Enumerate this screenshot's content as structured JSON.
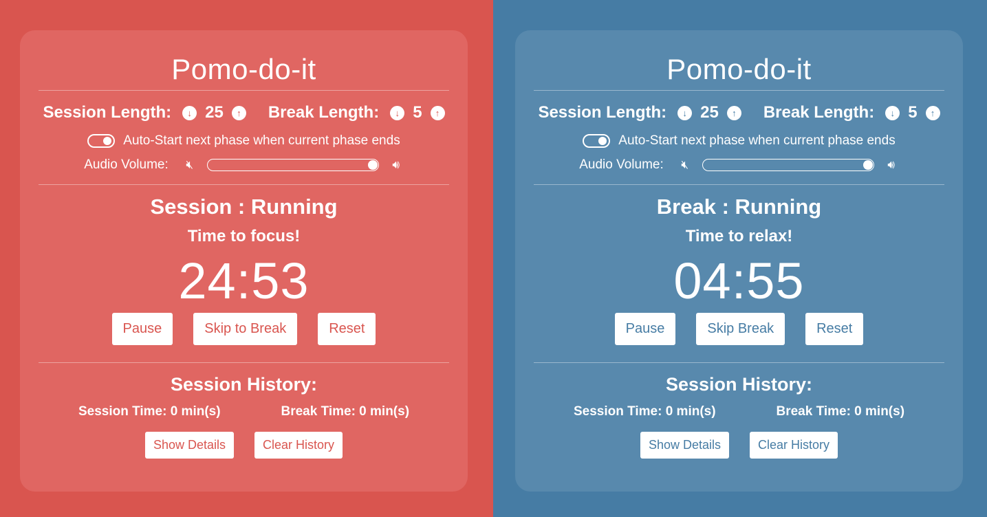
{
  "panels": [
    {
      "theme": "session",
      "accent_color": "#d9554f",
      "title": "Pomo-do-it",
      "session_length_label": "Session Length:",
      "session_length_value": "25",
      "break_length_label": "Break Length:",
      "break_length_value": "5",
      "decrement_icon": "arrow-down-icon",
      "increment_icon": "arrow-up-icon",
      "autostart_label": "Auto-Start next phase when current phase ends",
      "autostart_enabled": true,
      "volume_label": "Audio Volume:",
      "volume_level": 1.0,
      "status": "Session : Running",
      "message": "Time to focus!",
      "timer": "24:53",
      "pause_label": "Pause",
      "skip_label": "Skip to Break",
      "reset_label": "Reset",
      "history_title": "Session History:",
      "history_session_time": "Session Time: 0 min(s)",
      "history_break_time": "Break Time: 0 min(s)",
      "show_details_label": "Show Details",
      "clear_history_label": "Clear History"
    },
    {
      "theme": "break",
      "accent_color": "#467ca4",
      "title": "Pomo-do-it",
      "session_length_label": "Session Length:",
      "session_length_value": "25",
      "break_length_label": "Break Length:",
      "break_length_value": "5",
      "decrement_icon": "arrow-down-icon",
      "increment_icon": "arrow-up-icon",
      "autostart_label": "Auto-Start next phase when current phase ends",
      "autostart_enabled": true,
      "volume_label": "Audio Volume:",
      "volume_level": 1.0,
      "status": "Break : Running",
      "message": "Time to relax!",
      "timer": "04:55",
      "pause_label": "Pause",
      "skip_label": "Skip Break",
      "reset_label": "Reset",
      "history_title": "Session History:",
      "history_session_time": "Session Time: 0 min(s)",
      "history_break_time": "Break Time: 0 min(s)",
      "show_details_label": "Show Details",
      "clear_history_label": "Clear History"
    }
  ]
}
